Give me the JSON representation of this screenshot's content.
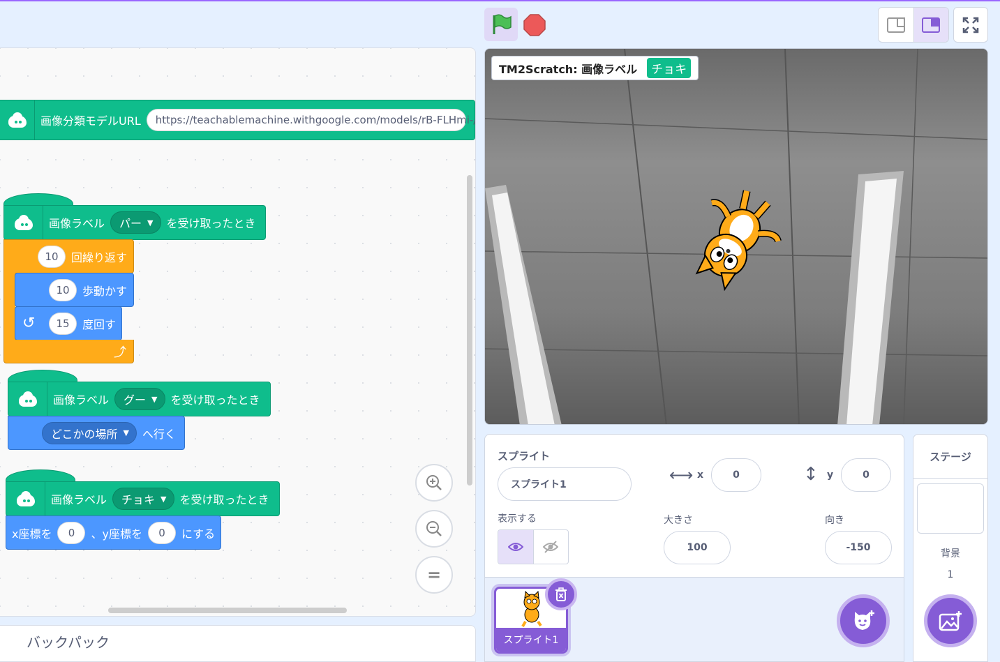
{
  "code": {
    "block_url": {
      "label": "画像分類モデルURL",
      "url": "https://teachablemachine.withgoogle.com/models/rB-FLHmi-/"
    },
    "hat_pa": {
      "prefix": "画像ラベル",
      "dropdown": "パー",
      "suffix": "を受け取ったとき"
    },
    "repeat": {
      "count": "10",
      "label": "回繰り返す"
    },
    "move": {
      "steps": "10",
      "label": "歩動かす"
    },
    "turn": {
      "degrees": "15",
      "label": "度回す"
    },
    "hat_gu": {
      "prefix": "画像ラベル",
      "dropdown": "グー",
      "suffix": "を受け取ったとき"
    },
    "goto": {
      "dropdown": "どこかの場所",
      "label": "へ行く"
    },
    "hat_choki": {
      "prefix": "画像ラベル",
      "dropdown": "チョキ",
      "suffix": "を受け取ったとき"
    },
    "setxy": {
      "x_label": "x座標を",
      "x": "0",
      "y_label": "、y座標を",
      "y": "0",
      "suffix": "にする"
    }
  },
  "backpack": {
    "label": "バックパック"
  },
  "stage": {
    "monitor_label": "TM2Scratch: 画像ラベル",
    "monitor_value": "チョキ"
  },
  "sprite_info": {
    "sprite_label": "スプライト",
    "sprite_name": "スプライト1",
    "x_label": "x",
    "x_value": "0",
    "y_label": "y",
    "y_value": "0",
    "show_label": "表示する",
    "size_label": "大きさ",
    "size_value": "100",
    "direction_label": "向き",
    "direction_value": "-150"
  },
  "sprite_list": {
    "items": [
      {
        "name": "スプライト1"
      }
    ]
  },
  "stage_panel": {
    "title": "ステージ",
    "backdrop_label": "背景",
    "backdrop_count": "1"
  },
  "colors": {
    "extension": "#0fbd8c",
    "control": "#ffab19",
    "motion": "#4c97ff",
    "accent": "#855cd6"
  },
  "icons": [
    "green-flag-icon",
    "stop-icon",
    "small-stage-icon",
    "large-stage-icon",
    "fullscreen-icon",
    "zoom-in-icon",
    "zoom-out-icon",
    "zoom-reset-icon",
    "eye-icon",
    "eye-slash-icon",
    "trash-icon",
    "choose-sprite-icon",
    "choose-backdrop-icon"
  ]
}
